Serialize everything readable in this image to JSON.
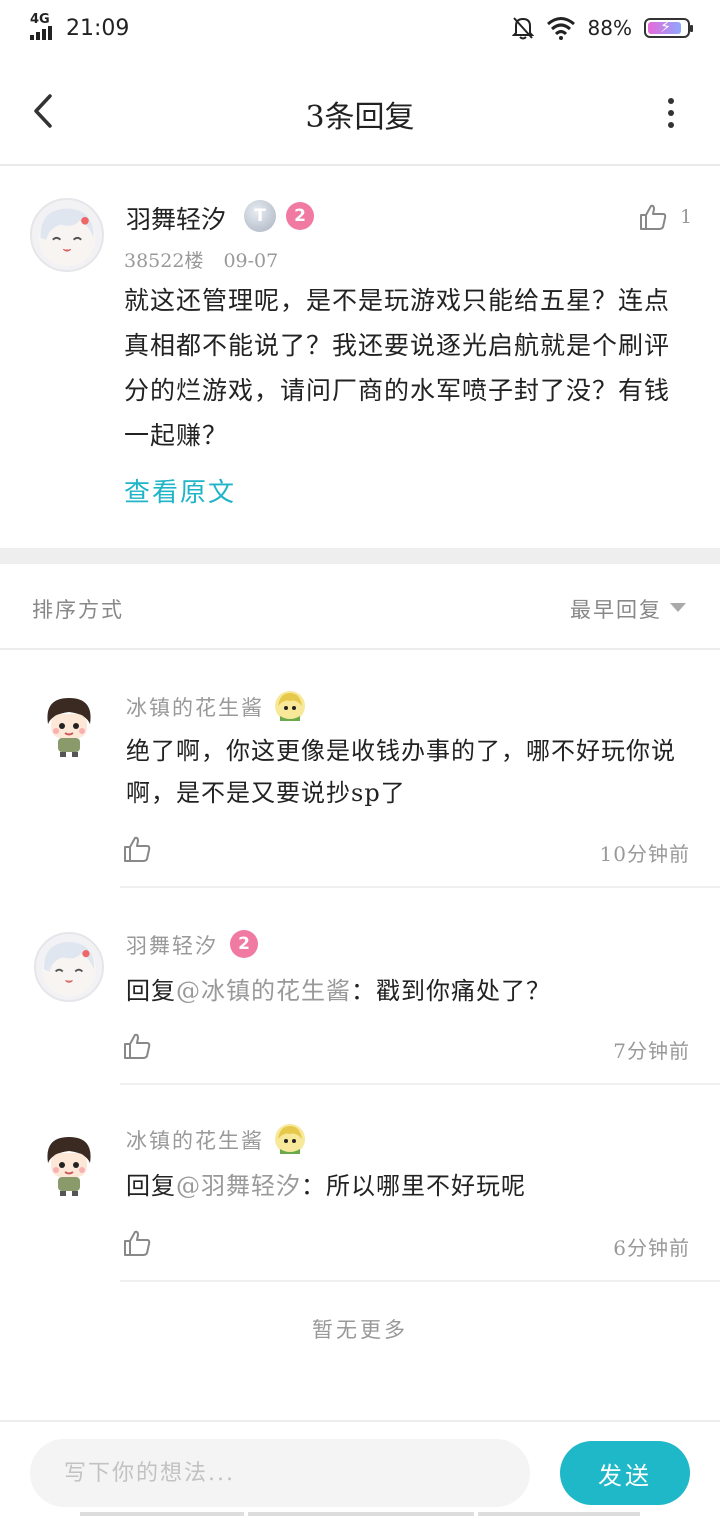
{
  "status": {
    "network": "4G",
    "time": "21:09",
    "battery": "88%"
  },
  "header": {
    "title": "3条回复"
  },
  "main_comment": {
    "username": "羽舞轻汐",
    "badge_text": "T",
    "level": "2",
    "likes": "1",
    "floor": "38522楼",
    "date": "09-07",
    "text": "就这还管理呢，是不是玩游戏只能给五星？连点真相都不能说了？我还要说逐光启航就是个刷评分的烂游戏，请问厂商的水军喷子封了没？有钱一起赚？",
    "view_original": "查看原文"
  },
  "sort": {
    "label": "排序方式",
    "selected": "最早回复"
  },
  "replies": [
    {
      "username": "冰镇的花生酱",
      "prefix": "",
      "at": "",
      "text": "绝了啊，你这更像是收钱办事的了，哪不好玩你说啊，是不是又要说抄sp了",
      "time": "10分钟前"
    },
    {
      "username": "羽舞轻汐",
      "level": "2",
      "prefix": "回复",
      "at": "@冰镇的花生酱",
      "text": "：戳到你痛处了？",
      "time": "7分钟前"
    },
    {
      "username": "冰镇的花生酱",
      "prefix": "回复",
      "at": "@羽舞轻汐",
      "text": "：所以哪里不好玩呢",
      "time": "6分钟前"
    }
  ],
  "footer": {
    "no_more": "暂无更多"
  },
  "composer": {
    "placeholder": "写下你的想法...",
    "send_label": "发送"
  },
  "colors": {
    "accent": "#1fb8c8",
    "link": "#1fb4c7",
    "level_badge": "#f07aa2"
  }
}
